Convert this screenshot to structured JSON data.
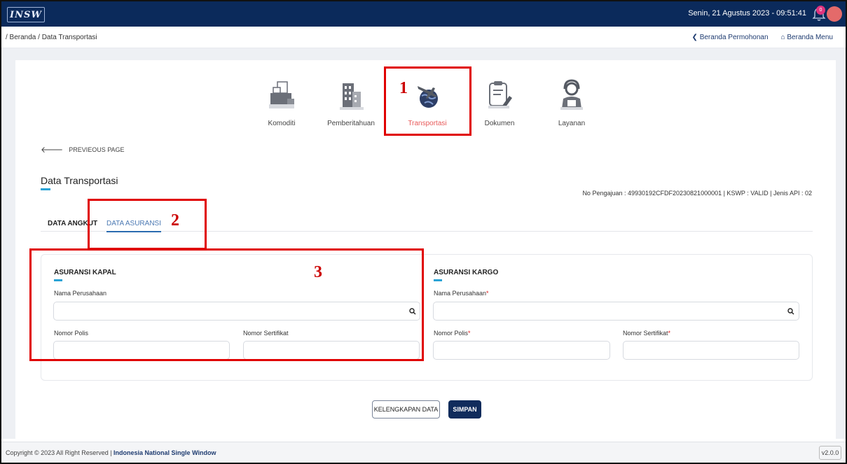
{
  "header": {
    "logo_text": "INSW",
    "datetime": "Senin, 21 Agustus 2023 - 09:51:41",
    "notification_count": "0"
  },
  "breadcrumb": {
    "path": "/ Beranda / Data Transportasi",
    "links": [
      {
        "label": "Beranda Permohonan",
        "icon": "chevron-left-icon"
      },
      {
        "label": "Beranda Menu",
        "icon": "home-icon"
      }
    ]
  },
  "steps": [
    {
      "label": "Komoditi",
      "icon": "boxes-icon",
      "active": false
    },
    {
      "label": "Pemberitahuan",
      "icon": "building-icon",
      "active": false
    },
    {
      "label": "Transportasi",
      "icon": "globe-plane-icon",
      "active": true
    },
    {
      "label": "Dokumen",
      "icon": "document-edit-icon",
      "active": false
    },
    {
      "label": "Layanan",
      "icon": "agent-icon",
      "active": false
    }
  ],
  "prev_page": "PREVIEOUS PAGE",
  "page": {
    "title": "Data Transportasi",
    "info": "No Pengajuan : 49930192CFDF20230821000001 | KSWP : VALID | Jenis API : 02"
  },
  "tabs": {
    "data_angkut": "DATA ANGKUT",
    "data_asuransi": "DATA ASURANSI"
  },
  "asuransi_kapal": {
    "title": "ASURANSI KAPAL",
    "nama_label": "Nama Perusahaan",
    "nama_value": "",
    "polis_label": "Nomor Polis",
    "polis_value": "",
    "sertifikat_label": "Nomor Sertifikat",
    "sertifikat_value": ""
  },
  "asuransi_kargo": {
    "title": "ASURANSI KARGO",
    "nama_label": "Nama Perusahaan",
    "nama_value": "",
    "polis_label": "Nomor Polis",
    "polis_value": "",
    "sertifikat_label": "Nomor Sertifikat",
    "sertifikat_value": "",
    "required_mark": "*"
  },
  "buttons": {
    "kelengkapan": "KELENGKAPAN DATA",
    "simpan": "SIMPAN"
  },
  "footer": {
    "copyright": "Copyright © 2023 All Right Reserved | ",
    "brand": "Indonesia National Single Window",
    "version": "v2.0.0"
  },
  "annotations": [
    "1",
    "2",
    "3"
  ],
  "colors": {
    "header_bg": "#0b2a5b",
    "active_step": "#e85a5a",
    "accent": "#29a3d6",
    "primary_button": "#102c5c",
    "annotation": "#e00000"
  }
}
